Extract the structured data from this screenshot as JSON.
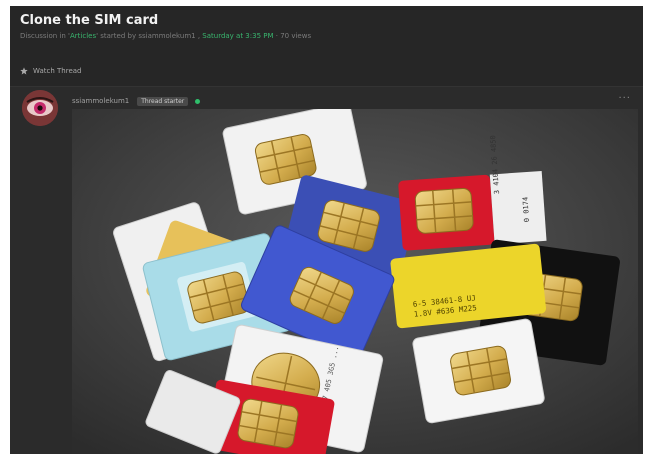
{
  "thread": {
    "title": "Clone the SIM card",
    "meta": {
      "prefix": "Discussion in '",
      "forum": "Articles",
      "middle": "' started by ",
      "author": "ssiammolekum1",
      "comma": " , ",
      "date": "Saturday at 3:35 PM",
      "views": " · 70 views"
    }
  },
  "watch": {
    "label": "Watch Thread",
    "icon": "star-icon"
  },
  "post": {
    "author": "ssiammolekum1",
    "badge": "Thread starter",
    "more": "···",
    "card_print_1": "3 4104 26 4850",
    "card_print_2": "0 0174",
    "card_print_3": "6-5 38461-8 UJ",
    "card_print_4": "1.8V #636 M225",
    "card_print_5": "57 405 3G5 ..."
  },
  "colors": {
    "page_bg": "#262626",
    "accent_link": "#39b56e",
    "online_dot": "#2fbf6b"
  }
}
